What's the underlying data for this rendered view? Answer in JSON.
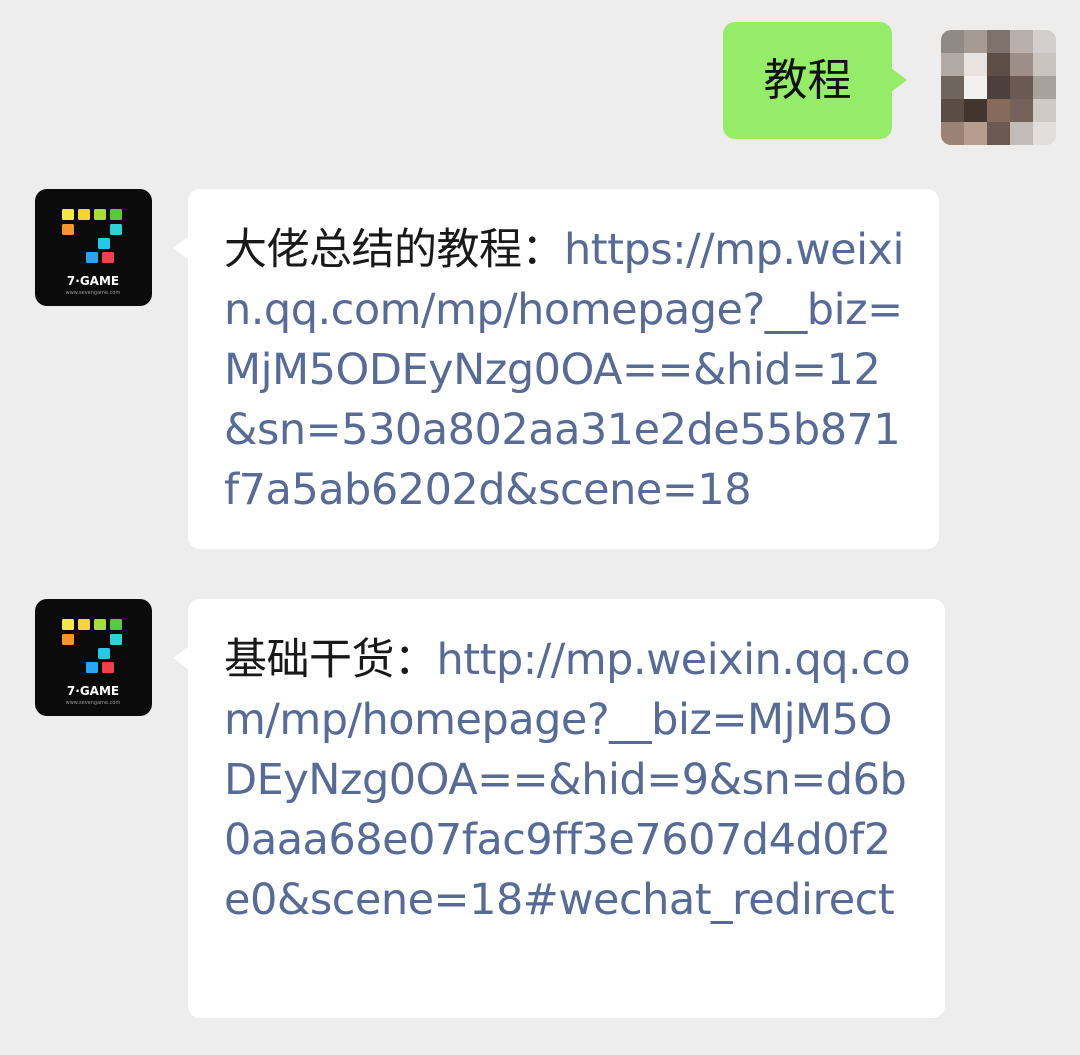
{
  "chat": {
    "outgoing": {
      "text": "教程",
      "bubble_color": "#95ec69"
    },
    "incoming": [
      {
        "prefix": "大佬总结的教程：",
        "link": "https://mp.weixin.qq.com/mp/homepage?__biz=MjM5ODEyNzg0OA==&hid=12&sn=530a802aa31e2de55b871f7a5ab6202d&scene=18",
        "avatar_label": "7·GAME",
        "avatar_sublabel": "www.sevengame.com"
      },
      {
        "prefix": "基础干货：",
        "link": "http://mp.weixin.qq.com/mp/homepage?__biz=MjM5ODEyNzg0OA==&hid=9&sn=d6b0aaa68e07fac9ff3e7607d4d0f2e0&scene=18#wechat_redirect",
        "avatar_label": "7·GAME",
        "avatar_sublabel": "www.sevengame.com"
      }
    ],
    "colors": {
      "background": "#ededed",
      "link": "#576b95",
      "incoming_bubble": "#ffffff"
    }
  }
}
